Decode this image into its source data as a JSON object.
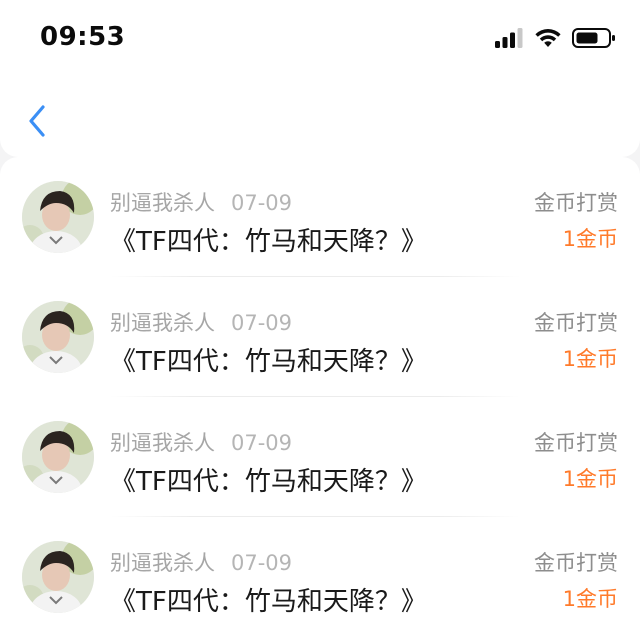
{
  "status_bar": {
    "time": "09:53",
    "icons": [
      "cellular-signal-icon",
      "wifi-icon",
      "battery-icon"
    ]
  },
  "nav": {
    "back_icon": "chevron-left-icon"
  },
  "colors": {
    "accent_blue": "#3b8ff5",
    "reward_orange": "#ff7a2a",
    "muted_gray": "#a6a6a6"
  },
  "items": [
    {
      "username": "别逼我杀人",
      "date": "07-09",
      "title": "《TF四代：竹马和天降？》",
      "reward_label": "金币打赏",
      "reward_amount": "1金币",
      "avatar_icon": "user-avatar"
    },
    {
      "username": "别逼我杀人",
      "date": "07-09",
      "title": "《TF四代：竹马和天降？》",
      "reward_label": "金币打赏",
      "reward_amount": "1金币",
      "avatar_icon": "user-avatar"
    },
    {
      "username": "别逼我杀人",
      "date": "07-09",
      "title": "《TF四代：竹马和天降？》",
      "reward_label": "金币打赏",
      "reward_amount": "1金币",
      "avatar_icon": "user-avatar"
    },
    {
      "username": "别逼我杀人",
      "date": "07-09",
      "title": "《TF四代：竹马和天降？》",
      "reward_label": "金币打赏",
      "reward_amount": "1金币",
      "avatar_icon": "user-avatar"
    }
  ]
}
